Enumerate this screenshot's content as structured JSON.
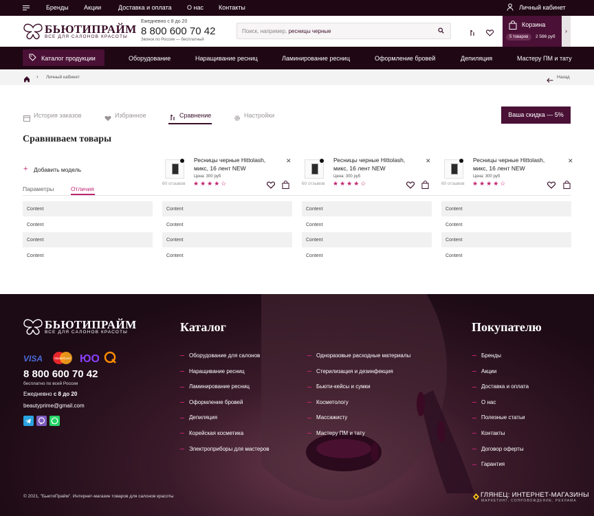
{
  "topbar": {
    "links": [
      "Бренды",
      "Акции",
      "Доставка и оплата",
      "О нас",
      "Контакты"
    ],
    "account": "Личный кабинет"
  },
  "header": {
    "logo_title": "БЬЮТИПРАЙМ",
    "logo_subtitle": "ВСЕ ДЛЯ САЛОНОВ КРАСОТЫ",
    "hours": "Ежедневно с 8 до 20",
    "phone": "8 800 600 70 42",
    "phone_note": "Звонок по России — бесплатный",
    "search_placeholder": "Поиск, например,",
    "search_example": "ресницы черные",
    "cart_label": "Корзина",
    "cart_count": "5 товаров",
    "cart_sum": "2 586 руб"
  },
  "nav": {
    "catalog": "Каталог продукции",
    "links": [
      "Оборудование",
      "Наращивание ресниц",
      "Ламинирование ресниц",
      "Оформление бровей",
      "Депиляция",
      "Мастеру ПМ и тату"
    ]
  },
  "breadcrumb": {
    "current": "Личный кабинет",
    "back": "Назад"
  },
  "tabs": [
    "История заказов",
    "Избранное",
    "Сравнение",
    "Настройки"
  ],
  "discount": "Ваша скидка — 5%",
  "compare": {
    "title": "Сравниваем товары",
    "add_model": "Добавить модель",
    "filter_params": "Параметры",
    "filter_diff": "Отличия",
    "products": [
      {
        "name": "Ресницы черные Hittolash, микс, 16 лент NEW",
        "price": "Цена: 300 руб",
        "reviews": "60 отзывов",
        "rating": 4
      },
      {
        "name": "Ресницы черные Hittolash, микс, 16 лент NEW",
        "price": "Цена: 300 руб",
        "reviews": "60 отзывов",
        "rating": 4
      },
      {
        "name": "Ресницы черные Hittolash, микс, 16 лент NEW",
        "price": "Цена: 300 руб",
        "reviews": "60 отзывов",
        "rating": 4
      }
    ],
    "cell_text": "Content"
  },
  "footer": {
    "logo_title": "БЬЮТИПРАЙМ",
    "logo_subtitle": "ВСЕ ДЛЯ САЛОНОВ КРАСОТЫ",
    "payments": [
      "VISA",
      "MasterCard",
      "ЮMoney",
      "QIWI"
    ],
    "phone": "8 800 600 70 42",
    "phone_note": "бесплатно по всей России",
    "hours_prefix": "Ежедневно",
    "hours_value": "с 8 до 20",
    "email_name": "beautyprime",
    "email_domain": "@gmail.com",
    "catalog_title": "Каталог",
    "catalog_col1": [
      "Оборудование для салонов",
      "Наращивание ресниц",
      "Ламинирование ресниц",
      "Оформление бровей",
      "Депиляция",
      "Корейская косметика",
      "Электроприборы для мастеров"
    ],
    "catalog_col2": [
      "Одноразовые расходные материалы",
      "Стерилизация и дезинфекция",
      "Бьюти-кейсы и сумки",
      "Косметологу",
      "Массажисту",
      "Мастеру ПМ и тату"
    ],
    "buyer_title": "Покупателю",
    "buyer_links": [
      "Бренды",
      "Акции",
      "Доставка и оплата",
      "О нас",
      "Полезные статьи",
      "Контакты",
      "Договор оферты",
      "Гарантия"
    ],
    "copyright": "© 2021, \"БьютиПрайм\". Интернет-магазин товаров для салонов красоты",
    "dev_name": "ГЛЯНЕЦ: ИНТЕРНЕТ-МАГАЗИНЫ",
    "dev_tagline": "МАРКЕТИНГ, СОПРОВОЖДЕНИЕ, РЕКЛАМА"
  },
  "colors": {
    "brand": "#4a1035",
    "dark": "#1f0714",
    "accent": "#c0246f"
  }
}
